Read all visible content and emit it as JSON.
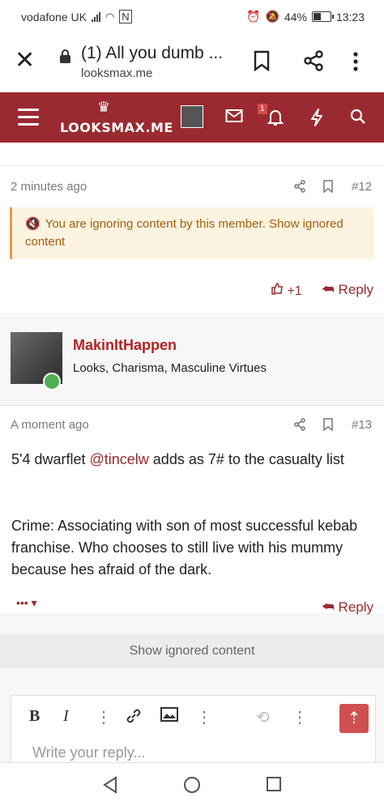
{
  "status": {
    "carrier": "vodafone UK",
    "battery": "44%",
    "time": "13:23"
  },
  "browser": {
    "tab_title": "(1) All you dumb ...",
    "domain": "looksmax.me"
  },
  "site": {
    "logo": "LOOKSMAX.ME",
    "notif_count": "1"
  },
  "posts": [
    {
      "time": "2 minutes ago",
      "number": "#12",
      "warning": "You are ignoring content by this member. Show ignored content",
      "reaction_count": "+1",
      "reply_label": "Reply"
    },
    {
      "username": "MakinItHappen",
      "user_title": "Looks, Charisma, Masculine Virtues",
      "time": "A moment ago",
      "number": "#13",
      "message_line1_before": "5'4 dwarflet ",
      "mention": "@tincelw",
      "message_line1_after": " adds as 7# to the casualty list",
      "message_para2": "Crime: Associating with son of most successful kebab franchise. Who chooses to still live with his mummy because hes afraid of the dark.",
      "reply_label": "Reply"
    }
  ],
  "show_ignored": "Show ignored content",
  "editor": {
    "placeholder": "Write your reply..."
  },
  "colors": {
    "brand": "#9a2a2f",
    "warning_bg": "#fdf3e1",
    "warning_text": "#a35f0a"
  }
}
